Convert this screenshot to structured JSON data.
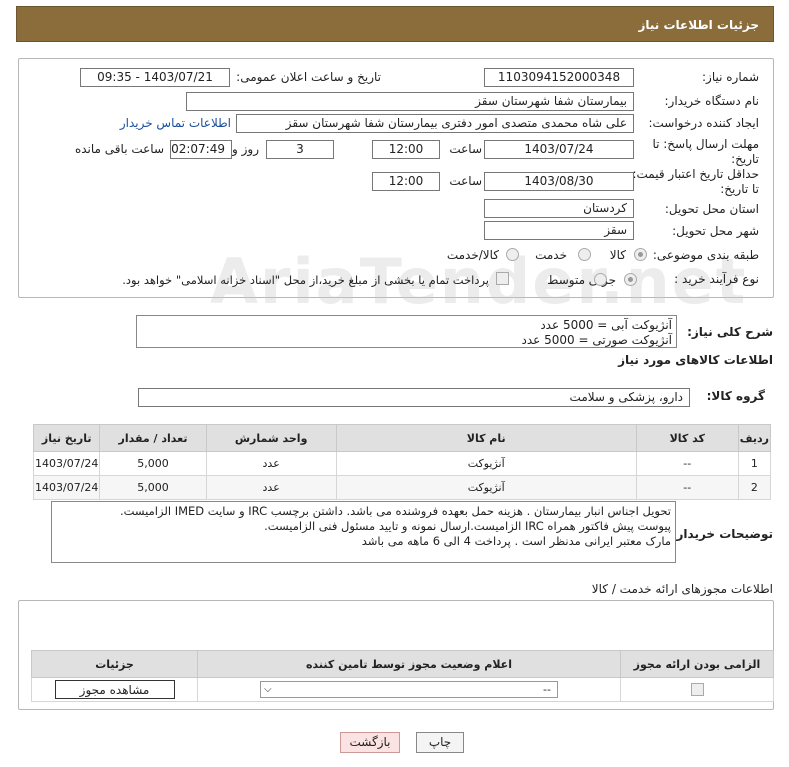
{
  "header": {
    "title": "جزئیات اطلاعات نیاز"
  },
  "form": {
    "need_number_label": "شماره نیاز:",
    "need_number": "1103094152000348",
    "announce_label": "تاریخ و ساعت اعلان عمومی:",
    "announce_value": "1403/07/21 - 09:35",
    "buyer_org_label": "نام دستگاه خریدار:",
    "buyer_org": "بیمارستان شفا شهرستان سقز",
    "requester_label": "ایجاد کننده درخواست:",
    "requester": "علی شاه محمدی متصدی امور دفتری بیمارستان شفا شهرستان سقز",
    "contact_link": "اطلاعات تماس خریدار",
    "deadline_label": "مهلت ارسال پاسخ: تا تاریخ:",
    "deadline_date": "1403/07/24",
    "time_label": "ساعت",
    "deadline_time": "12:00",
    "days_value": "3",
    "days_label": "روز و",
    "remaining_time": "02:07:49",
    "remaining_label": "ساعت باقی مانده",
    "price_validity_label": "حداقل تاریخ اعتبار قیمت: تا تاریخ:",
    "price_validity_date": "1403/08/30",
    "price_validity_time": "12:00",
    "province_label": "استان محل تحویل:",
    "province": "کردستان",
    "city_label": "شهر محل تحویل:",
    "city": "سقز",
    "category_label": "طبقه بندی موضوعی:",
    "category_options": [
      "کالا",
      "خدمت",
      "کالا/خدمت"
    ],
    "process_label": "نوع فرآیند خرید :",
    "process_options": [
      "جزیی",
      "متوسط"
    ],
    "payment_note": "پرداخت تمام یا بخشی از مبلغ خرید،از محل \"اسناد خزانه اسلامی\" خواهد بود."
  },
  "summary": {
    "label": "شرح کلی نیاز:",
    "lines": [
      "آنژیوکت آبی = 5000 عدد",
      "آنژیوکت صورتی = 5000 عدد"
    ]
  },
  "goods": {
    "section_title": "اطلاعات کالاهای مورد نیاز",
    "group_label": "گروه کالا:",
    "group_value": "دارو، پزشکی و سلامت",
    "columns": [
      "ردیف",
      "کد کالا",
      "نام کالا",
      "واحد شمارش",
      "تعداد / مقدار",
      "تاریخ نیاز"
    ],
    "rows": [
      [
        "1",
        "--",
        "آنژیوکت",
        "عدد",
        "5,000",
        "1403/07/24"
      ],
      [
        "2",
        "--",
        "آنژیوکت",
        "عدد",
        "5,000",
        "1403/07/24"
      ]
    ]
  },
  "buyer_notes": {
    "label": "توضیحات خریدار:",
    "lines": [
      "تحویل اجناس  انبار بیمارستان . هزینه حمل بعهده فروشنده می باشد.  داشتن برچسب IRC  و سایت  IMED  الزامیست.",
      "پیوست پیش فاکتور همراه IRC  الزامیست.ارسال نمونه و تایید مسئول فنی الزامیست.",
      "مارک معتبر ایرانی مدنظر است . پرداخت 4 الی 6 ماهه می باشد"
    ]
  },
  "permits": {
    "section_title": "اطلاعات مجوزهای ارائه خدمت / کالا",
    "columns": [
      "الزامی بودن ارائه مجوز",
      "اعلام وضعیت مجوز توسط تامین کننده",
      "جزئیات"
    ],
    "status_value": "--",
    "view_button": "مشاهده مجوز"
  },
  "buttons": {
    "print": "چاپ",
    "back": "بازگشت"
  },
  "watermark": "AriaTender.net",
  "colors": {
    "header_bg": "#8a6d3b",
    "link": "#1a4f9c",
    "back_button_bg": "#fbe3e3"
  }
}
